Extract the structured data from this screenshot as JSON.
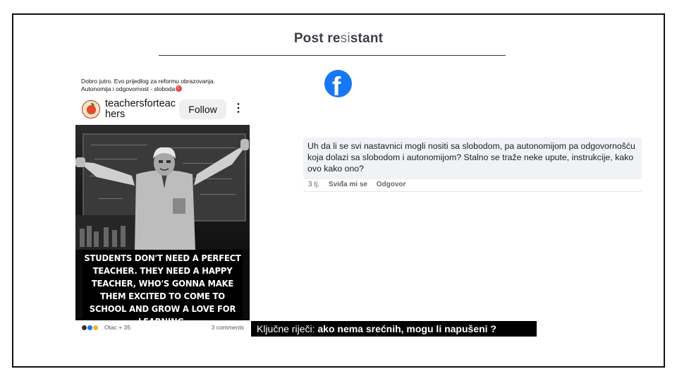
{
  "slide": {
    "title_part1": "Post re",
    "title_part2": "si",
    "title_part3": "stant"
  },
  "post": {
    "caption_line1": "Dobro jutro. Evo prijedlog za reformu obrazovanja.",
    "caption_line2": "Autonomija i odgovornost - sloboda",
    "account_handle": "teachersforteachers",
    "follow_label": "Follow",
    "more_icon": "⋮",
    "quote_text": "STUDENTS DON'T NEED A PERFECT TEACHER. THEY NEED A HAPPY TEACHER, WHO'S GONNA MAKE THEM EXCITED TO COME TO SCHOOL AND GROW A LOVE FOR LEARNING.",
    "reaction_names": "Otac + 35",
    "comments_count": "3 comments",
    "reaction_icons": [
      "care-reaction-icon",
      "like-reaction-icon",
      "haha-reaction-icon"
    ]
  },
  "keywords": {
    "label": "Ključne riječi: ",
    "text": "ako nema srećnih, mogu li napušeni ?"
  },
  "facebook": {
    "logo_letter": "f",
    "brand_color": "#1877f2"
  },
  "comment": {
    "text": "Uh da li se svi nastavnici mogli nositi sa slobodom, pa autonomijom pa odgovornošću koja dolazi sa slobodom i autonomijom? Stalno se traže neke upute, instrukcije, kako ovo kako ono?",
    "time": "3 tj.",
    "like_label": "Sviđa mi se",
    "reply_label": "Odgovor"
  }
}
